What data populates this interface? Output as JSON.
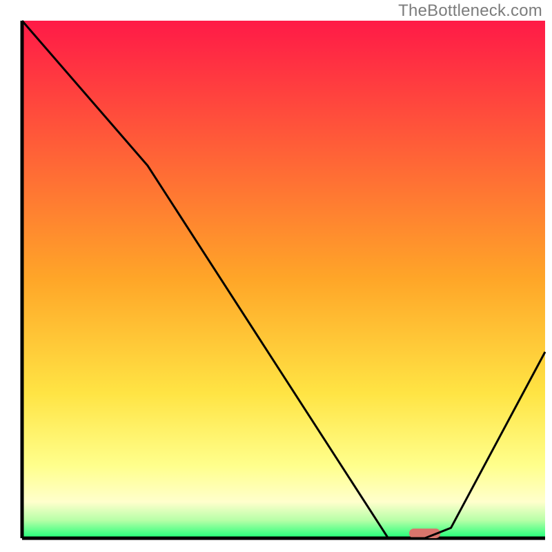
{
  "watermark": "TheBottleneck.com",
  "chart_data": {
    "type": "line",
    "title": "",
    "xlabel": "",
    "ylabel": "",
    "xlim": [
      0,
      100
    ],
    "ylim": [
      0,
      100
    ],
    "x": [
      0,
      24,
      70,
      77,
      82,
      100
    ],
    "values": [
      100,
      72,
      0,
      0,
      2,
      36
    ],
    "marker": {
      "x_range": [
        74,
        80
      ],
      "y": 0,
      "color": "#d9756c"
    },
    "gradient_stops": [
      {
        "offset": 0.0,
        "color": "#ff1a47"
      },
      {
        "offset": 0.5,
        "color": "#ffa628"
      },
      {
        "offset": 0.72,
        "color": "#ffe444"
      },
      {
        "offset": 0.86,
        "color": "#ffff8c"
      },
      {
        "offset": 0.93,
        "color": "#ffffcc"
      },
      {
        "offset": 0.965,
        "color": "#b8ffa8"
      },
      {
        "offset": 1.0,
        "color": "#1dff78"
      }
    ],
    "axis_color": "#000000",
    "line_color": "#000000"
  }
}
